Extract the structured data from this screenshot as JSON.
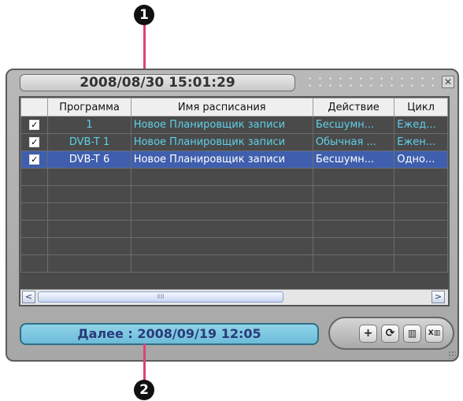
{
  "callouts": {
    "top": "1",
    "bottom": "2"
  },
  "window": {
    "datetime": "2008/08/30 15:01:29",
    "close_glyph": "✕"
  },
  "table": {
    "headers": {
      "program": "Программа",
      "schedule_name": "Имя расписания",
      "action": "Действие",
      "cycle": "Цикл"
    },
    "rows": [
      {
        "checked": true,
        "program": "1",
        "schedule_name": "Новое Планировщик записи",
        "action": "Бесшумн...",
        "cycle": "Ежед..."
      },
      {
        "checked": true,
        "program": "DVB-T 1",
        "schedule_name": "Новое Планировщик записи",
        "action": "Обычная ...",
        "cycle": "Ежен..."
      },
      {
        "checked": true,
        "program": "DVB-T 6",
        "schedule_name": "Новое Планировщик записи",
        "action": "Бесшумн...",
        "cycle": "Одно..."
      }
    ],
    "check_glyph": "✓",
    "selected_row": 2,
    "empty_rows": 6
  },
  "scrollbar": {
    "left": "<",
    "right": ">",
    "thumb_grip": "IIII"
  },
  "footer": {
    "next_label": "Далее : 2008/09/19 12:05"
  },
  "toolbar": {
    "add": "+",
    "refresh": "⟳",
    "delete": "▥",
    "delete_all": "X▥"
  },
  "colors": {
    "accent_selected": "#3f5fae",
    "row_text": "#5fd0e8",
    "callout_line": "#e0407a",
    "next_pill": "#7cc7e0"
  }
}
